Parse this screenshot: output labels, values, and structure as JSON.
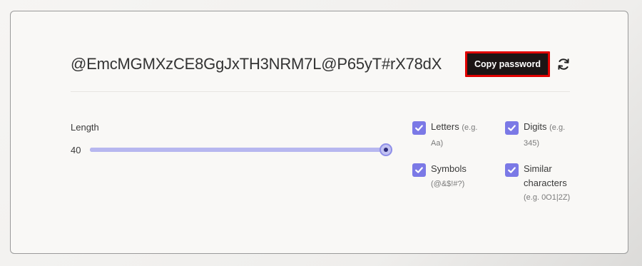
{
  "generator": {
    "password": "@EmcMGMXzCE8GgJxTH3NRM7L@P65yT#rX78dX",
    "copy_label": "Copy password",
    "refresh_icon": "refresh-icon"
  },
  "length": {
    "label": "Length",
    "value": "40",
    "fraction": 1.0
  },
  "options": {
    "letters": {
      "label": "Letters",
      "example": "(e.g. Aa)",
      "checked": true
    },
    "digits": {
      "label": "Digits",
      "example": "(e.g. 345)",
      "checked": true
    },
    "symbols": {
      "label": "Symbols",
      "example": "(@&$!#?)",
      "checked": true
    },
    "similar": {
      "label": "Similar characters",
      "example": "(e.g. 0O1|2Z)",
      "checked": true
    }
  },
  "colors": {
    "accent": "#7b79e6",
    "copy_bg": "#1c1515",
    "highlight": "#e00000"
  }
}
